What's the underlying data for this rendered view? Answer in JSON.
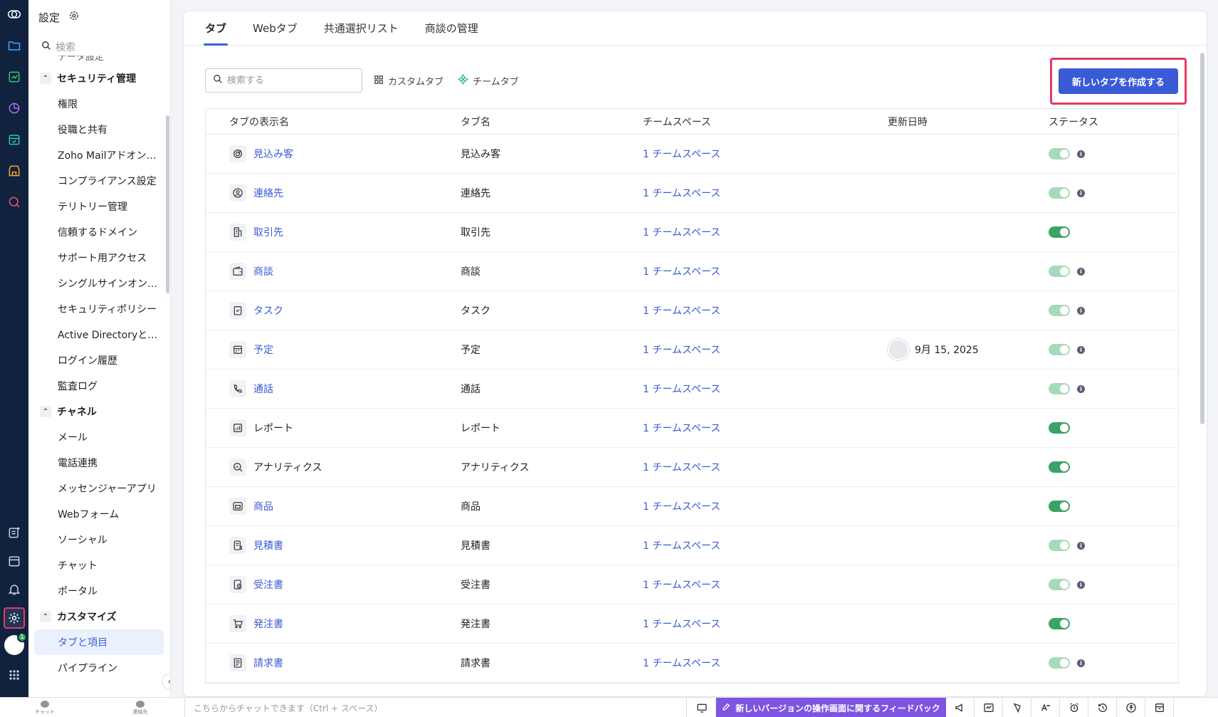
{
  "sidebar": {
    "title": "設定",
    "search_placeholder": "検索",
    "cut_item": "データ設定",
    "groups": [
      {
        "label": "セキュリティ管理",
        "items": [
          "権限",
          "役職と共有",
          "Zoho Mailアドオン…",
          "コンプライアンス設定",
          "テリトリー管理",
          "信頼するドメイン",
          "サポート用アクセス",
          "シングルサインオン…",
          "セキュリティポリシー",
          "Active Directoryと…",
          "ログイン履歴",
          "監査ログ"
        ]
      },
      {
        "label": "チャネル",
        "items": [
          "メール",
          "電話連携",
          "メッセンジャーアプリ",
          "Webフォーム",
          "ソーシャル",
          "チャット",
          "ポータル"
        ]
      },
      {
        "label": "カスタマイズ",
        "items": [
          "タブと項目",
          "パイプライン"
        ]
      }
    ],
    "selected": "タブと項目"
  },
  "main": {
    "tabs": [
      {
        "label": "タブ",
        "active": true
      },
      {
        "label": "Webタブ",
        "active": false
      },
      {
        "label": "共通選択リスト",
        "active": false
      },
      {
        "label": "商談の管理",
        "active": false
      }
    ],
    "search_placeholder": "検索する",
    "filter_custom": "カスタムタブ",
    "filter_team": "チームタブ",
    "create_button": "新しいタブを作成する"
  },
  "table": {
    "columns": [
      "タブの表示名",
      "タブ名",
      "チームスペース",
      "更新日時",
      "ステータス"
    ],
    "rows": [
      {
        "display": "見込み客",
        "name": "見込み客",
        "team": "1 チームスペース",
        "updated": "",
        "status": "dim",
        "info": true,
        "icon": "target-icon",
        "link": true
      },
      {
        "display": "連絡先",
        "name": "連絡先",
        "team": "1 チームスペース",
        "updated": "",
        "status": "dim",
        "info": true,
        "icon": "contact-icon",
        "link": true
      },
      {
        "display": "取引先",
        "name": "取引先",
        "team": "1 チームスペース",
        "updated": "",
        "status": "on",
        "info": false,
        "icon": "building-icon",
        "link": true
      },
      {
        "display": "商談",
        "name": "商談",
        "team": "1 チームスペース",
        "updated": "",
        "status": "dim",
        "info": true,
        "icon": "wallet-icon",
        "link": true
      },
      {
        "display": "タスク",
        "name": "タスク",
        "team": "1 チームスペース",
        "updated": "",
        "status": "dim",
        "info": true,
        "icon": "task-icon",
        "link": true
      },
      {
        "display": "予定",
        "name": "予定",
        "team": "1 チームスペース",
        "updated": "9月 15, 2025",
        "status": "dim",
        "info": true,
        "icon": "calendar-icon",
        "link": true
      },
      {
        "display": "通話",
        "name": "通話",
        "team": "1 チームスペース",
        "updated": "",
        "status": "dim",
        "info": true,
        "icon": "phone-icon",
        "link": true
      },
      {
        "display": "レポート",
        "name": "レポート",
        "team": "1 チームスペース",
        "updated": "",
        "status": "on",
        "info": false,
        "icon": "report-icon",
        "link": false
      },
      {
        "display": "アナリティクス",
        "name": "アナリティクス",
        "team": "1 チームスペース",
        "updated": "",
        "status": "on",
        "info": false,
        "icon": "analytics-icon",
        "link": false
      },
      {
        "display": "商品",
        "name": "商品",
        "team": "1 チームスペース",
        "updated": "",
        "status": "on",
        "info": false,
        "icon": "product-icon",
        "link": true
      },
      {
        "display": "見積書",
        "name": "見積書",
        "team": "1 チームスペース",
        "updated": "",
        "status": "dim",
        "info": true,
        "icon": "quote-icon",
        "link": true
      },
      {
        "display": "受注書",
        "name": "受注書",
        "team": "1 チームスペース",
        "updated": "",
        "status": "dim",
        "info": true,
        "icon": "sales-order-icon",
        "link": true
      },
      {
        "display": "発注書",
        "name": "発注書",
        "team": "1 チームスペース",
        "updated": "",
        "status": "on",
        "info": false,
        "icon": "cart-icon",
        "link": true
      },
      {
        "display": "請求書",
        "name": "請求書",
        "team": "1 チームスペース",
        "updated": "",
        "status": "dim",
        "info": true,
        "icon": "invoice-icon",
        "link": true
      }
    ]
  },
  "bottom": {
    "chat_label": "チャット",
    "contacts_label": "連絡先",
    "chat_placeholder": "こちらからチャットできます（Ctrl + スペース）",
    "feedback": "新しいバージョンの操作画面に関するフィードバック"
  },
  "colors": {
    "accent": "#3a5bd6",
    "highlight": "#e8395f",
    "toggle_on": "#3aa365",
    "feedback": "#7d55e0",
    "rail": "#10223d"
  }
}
